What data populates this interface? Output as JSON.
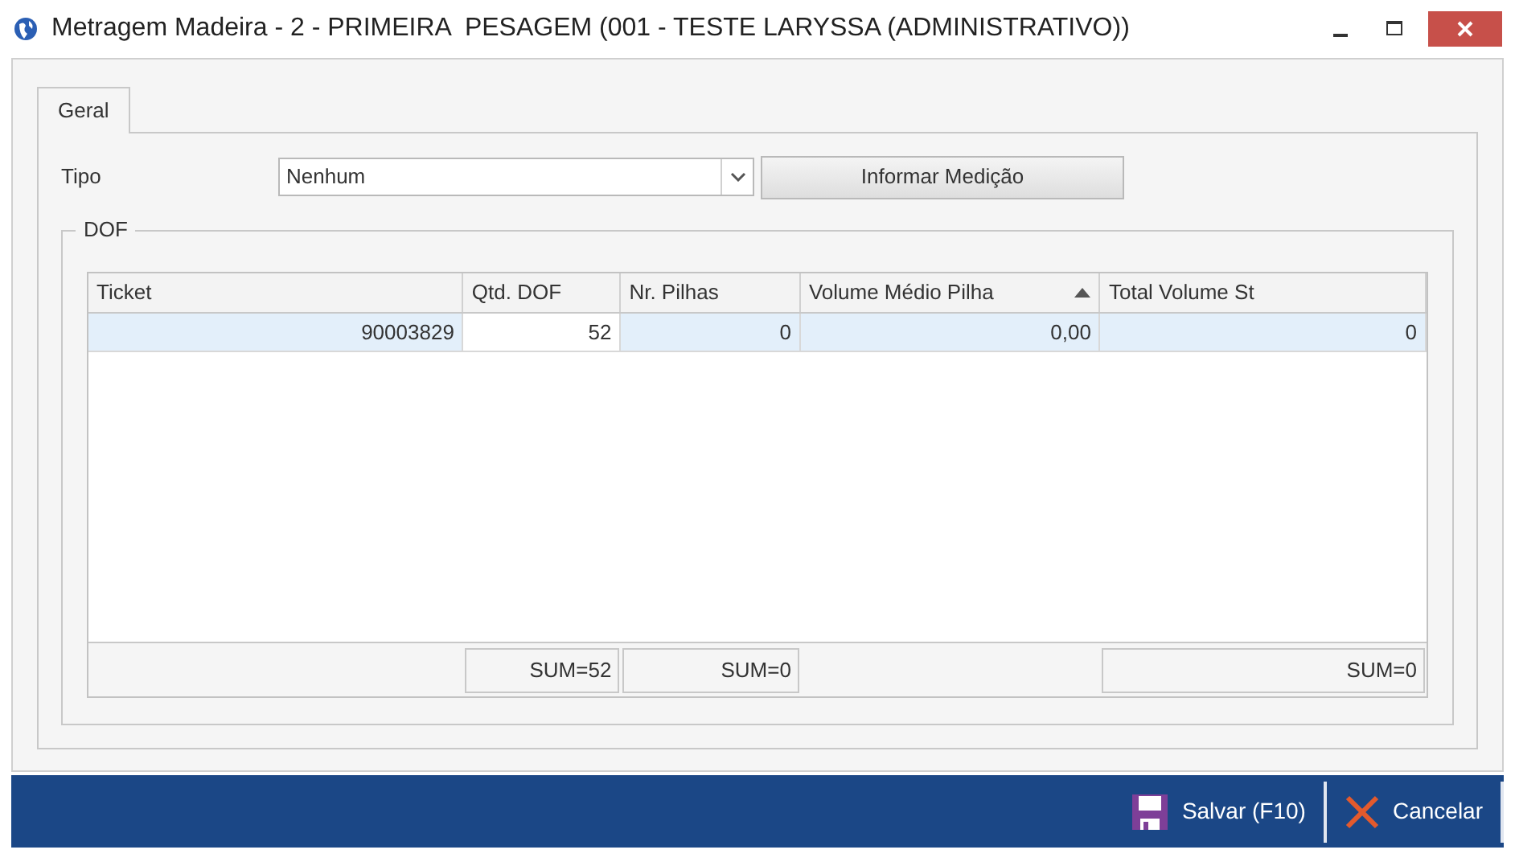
{
  "window": {
    "title": "Metragem Madeira - 2 - PRIMEIRA  PESAGEM (001 - TESTE LARYSSA (ADMINISTRATIVO))"
  },
  "tabs": [
    {
      "label": "Geral",
      "selected": true
    }
  ],
  "tipo": {
    "label": "Tipo",
    "value": "Nenhum"
  },
  "informar_button": "Informar Medição",
  "dof": {
    "title": "DOF",
    "columns": [
      {
        "label": "Ticket",
        "sorted": false
      },
      {
        "label": "Qtd. DOF",
        "sorted": false
      },
      {
        "label": "Nr. Pilhas",
        "sorted": false
      },
      {
        "label": "Volume Médio Pilha",
        "sorted": true
      },
      {
        "label": "Total Volume St",
        "sorted": false
      }
    ],
    "rows": [
      {
        "selected": true,
        "cells": [
          {
            "text": "90003829",
            "focused": false
          },
          {
            "text": "52",
            "focused": true
          },
          {
            "text": "0",
            "focused": false
          },
          {
            "text": "0,00",
            "focused": false
          },
          {
            "text": "0",
            "focused": false
          }
        ]
      }
    ],
    "summary_row": [
      {
        "kind": "blank"
      },
      {
        "kind": "sum",
        "text": "SUM=52"
      },
      {
        "kind": "sum",
        "text": "SUM=0"
      },
      {
        "kind": "blank"
      },
      {
        "kind": "sum",
        "text": "SUM=0"
      }
    ]
  },
  "buttons": [
    {
      "kind": "save",
      "label": "Salvar (F10)"
    },
    {
      "kind": "cancel",
      "label": "Cancelar"
    }
  ]
}
